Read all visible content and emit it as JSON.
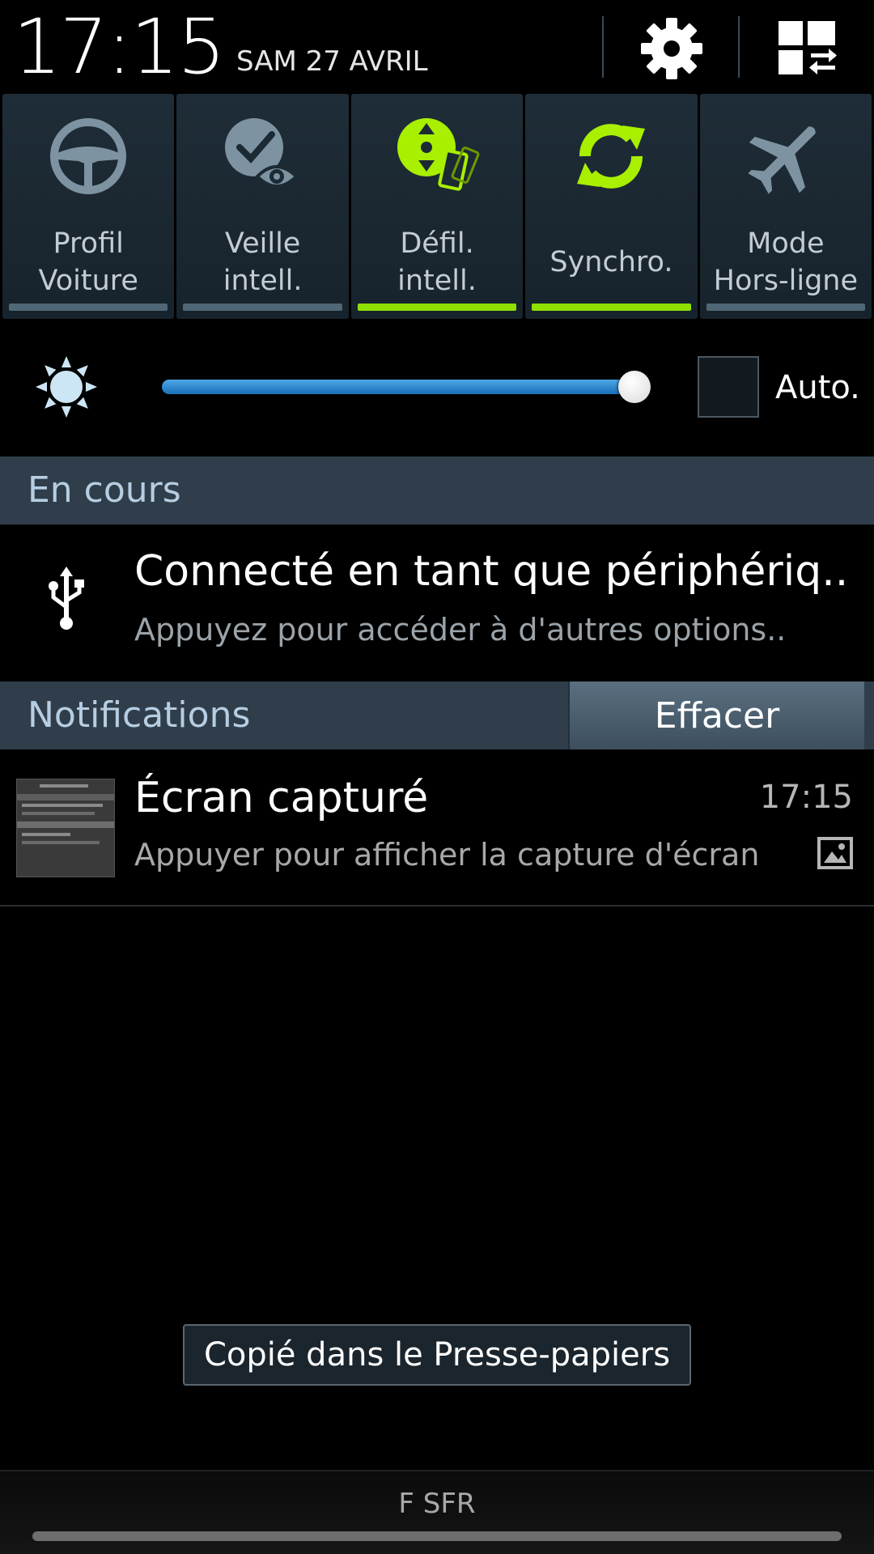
{
  "header": {
    "time": "17:15",
    "date": "SAM 27 AVRIL",
    "settings_icon": "gear-icon",
    "edit_icon": "quick-settings-edit-icon"
  },
  "toggles": [
    {
      "label": "Profil\nVoiture",
      "icon": "steering-wheel-icon",
      "active": false
    },
    {
      "label": "Veille\nintell.",
      "icon": "smart-stay-icon",
      "active": false
    },
    {
      "label": "Défil.\nintell.",
      "icon": "smart-scroll-icon",
      "active": true
    },
    {
      "label": "Synchro.",
      "icon": "sync-icon",
      "active": true
    },
    {
      "label": "Mode\nHors-ligne",
      "icon": "airplane-icon",
      "active": false
    }
  ],
  "brightness": {
    "level_fraction": 0.97,
    "auto_label": "Auto.",
    "auto_checked": false,
    "icon": "brightness-sun-icon"
  },
  "ongoing": {
    "section_title": "En cours",
    "usb": {
      "icon": "usb-icon",
      "title": "Connecté en tant que périphériq..",
      "subtitle": "Appuyez pour accéder à d'autres options.."
    }
  },
  "notifications": {
    "section_title": "Notifications",
    "clear_label": "Effacer",
    "items": [
      {
        "title": "Écran capturé",
        "subtitle": "Appuyer pour afficher la capture d'écran",
        "time": "17:15",
        "icon": "image-icon"
      }
    ]
  },
  "toast": "Copié dans le Presse-papiers",
  "carrier": "F SFR",
  "colors": {
    "accent_green": "#8fe000",
    "inactive_bar": "#4f6777",
    "section_bg": "#2f3e4a",
    "slider_blue": "#2a8ad6"
  }
}
